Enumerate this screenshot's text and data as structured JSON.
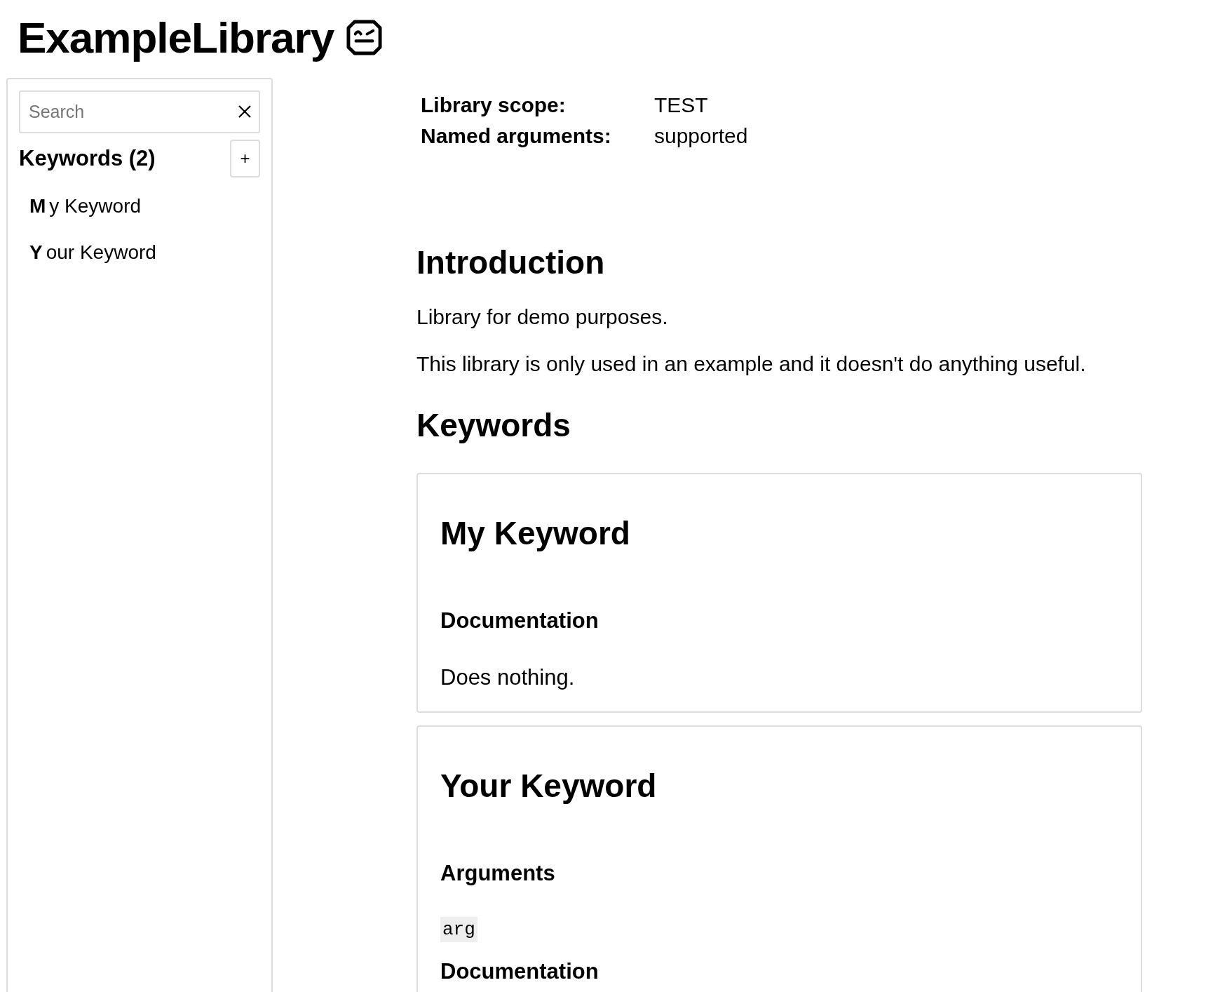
{
  "header": {
    "title": "ExampleLibrary"
  },
  "sidebar": {
    "search": {
      "placeholder": "Search"
    },
    "section_title": "Keywords (2)",
    "add_button": "+",
    "items": [
      {
        "label": "**M**y Keyword"
      },
      {
        "label": "**Y**our Keyword"
      }
    ]
  },
  "metadata": [
    {
      "label": "Library scope:",
      "value": "TEST"
    },
    {
      "label": "Named arguments:",
      "value": "supported"
    }
  ],
  "introduction": {
    "title": "Introduction",
    "paragraphs": [
      "Library for demo purposes.",
      "This library is only used in an example and it doesn't do anything useful."
    ]
  },
  "keywords": {
    "title": "Keywords",
    "items": [
      {
        "name": "My Keyword",
        "sections": [
          {
            "kind": "documentation",
            "title": "Documentation",
            "text": "Does nothing."
          }
        ]
      },
      {
        "name": "Your Keyword",
        "sections": [
          {
            "kind": "arguments",
            "title": "Arguments",
            "args": [
              "arg"
            ]
          },
          {
            "kind": "documentation",
            "title": "Documentation"
          }
        ]
      }
    ]
  }
}
